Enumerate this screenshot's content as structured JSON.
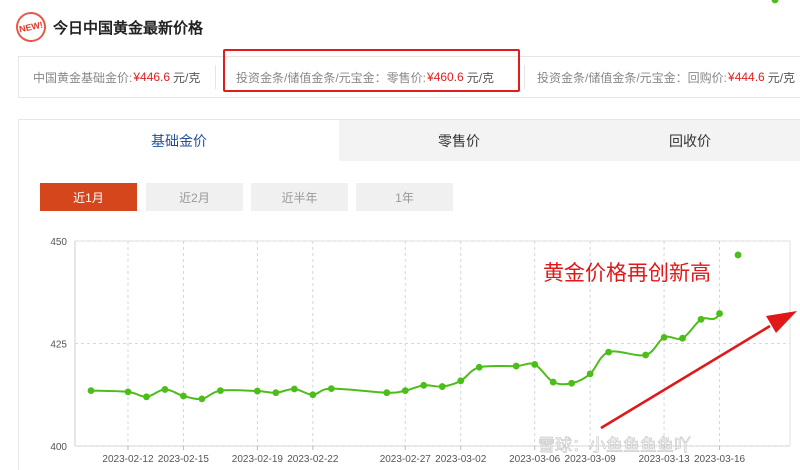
{
  "header": {
    "badge": "NEW!",
    "title": "今日中国黄金最新价格"
  },
  "prices": [
    {
      "label": "中国黄金基础金价:",
      "value": "¥446.6",
      "unit": "元/克"
    },
    {
      "label": "投资金条/储值金条/元宝金：零售价:",
      "value": "¥460.6",
      "unit": "元/克"
    },
    {
      "label": "投资金条/储值金条/元宝金：回购价:",
      "value": "¥444.6",
      "unit": "元/克"
    }
  ],
  "tabs": [
    {
      "label": "基础金价",
      "active": true
    },
    {
      "label": "零售价",
      "active": false
    },
    {
      "label": "回收价",
      "active": false
    }
  ],
  "ranges": [
    {
      "label": "近1月",
      "active": true
    },
    {
      "label": "近2月",
      "active": false
    },
    {
      "label": "近半年",
      "active": false
    },
    {
      "label": "1年",
      "active": false
    }
  ],
  "colors": {
    "line": "#4dbd1a",
    "accent": "#d6461c",
    "highlight": "#e21c1c",
    "annotation": "#e01818"
  },
  "chart_data": {
    "type": "line",
    "x": [
      "2023-02-10",
      "2023-02-12",
      "2023-02-13",
      "2023-02-14",
      "2023-02-15",
      "2023-02-16",
      "2023-02-17",
      "2023-02-19",
      "2023-02-20",
      "2023-02-21",
      "2023-02-22",
      "2023-02-23",
      "2023-02-26",
      "2023-02-27",
      "2023-02-28",
      "2023-03-01",
      "2023-03-02",
      "2023-03-03",
      "2023-03-05",
      "2023-03-06",
      "2023-03-07",
      "2023-03-08",
      "2023-03-09",
      "2023-03-10",
      "2023-03-12",
      "2023-03-13",
      "2023-03-14",
      "2023-03-15",
      "2023-03-16",
      "2023-03-17",
      "2023-03-19"
    ],
    "values": [
      413.5,
      413.2,
      412.0,
      413.8,
      412.2,
      411.5,
      413.5,
      413.4,
      413.0,
      413.9,
      412.5,
      414.0,
      413.0,
      413.5,
      414.8,
      414.5,
      415.9,
      419.2,
      419.5,
      419.9,
      415.6,
      415.3,
      417.6,
      422.9,
      422.2,
      426.5,
      426.3,
      430.9,
      432.3,
      446.6
    ],
    "xticks": [
      "2023-02-12",
      "2023-02-15",
      "2023-02-19",
      "2023-02-22",
      "2023-02-27",
      "2023-03-02",
      "2023-03-06",
      "2023-03-09",
      "2023-03-13",
      "2023-03-16"
    ],
    "yticks": [
      400,
      425,
      450
    ],
    "ylim": [
      400,
      450
    ],
    "grid": true,
    "annotation": "黄金价格再创新高",
    "watermark": "雪球：小鱼鱼鱼鱼吖"
  }
}
